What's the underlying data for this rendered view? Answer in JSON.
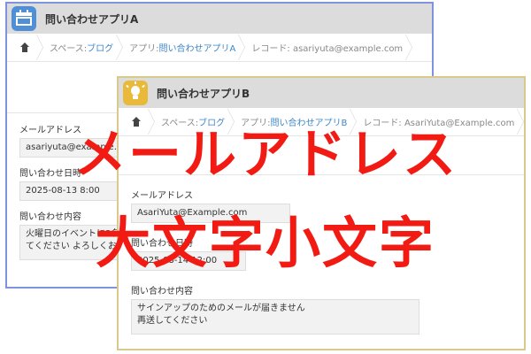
{
  "window_a": {
    "title": "問い合わせアプリA",
    "breadcrumb": {
      "space_prefix": "スペース: ",
      "space_link": "ブログ",
      "app_prefix": "アプリ: ",
      "app_link": "問い合わせアプリA",
      "record": "レコード: asariyuta@example.com"
    },
    "fields": [
      {
        "label": "メールアドレス",
        "value": "asariyuta@example.com"
      },
      {
        "label": "問い合わせ日時",
        "value": "2025-08-13 8:00"
      },
      {
        "label": "問い合わせ内容",
        "value": "火曜日のイベントに3名で参加させてください よろしくお願いします"
      }
    ],
    "border_color": "#7f93dc",
    "icon": "calendar-icon"
  },
  "window_b": {
    "title": "問い合わせアプリB",
    "breadcrumb": {
      "space_prefix": "スペース: ",
      "space_link": "ブログ",
      "app_prefix": "アプリ: ",
      "app_link": "問い合わせアプリB",
      "record": "レコード: AsariYuta@Example.com"
    },
    "fields": [
      {
        "label": "メールアドレス",
        "value": "AsariYuta@Example.com"
      },
      {
        "label": "問い合わせ日時",
        "value": "2025-08-14 12:00"
      },
      {
        "label": "問い合わせ内容",
        "value_line1": "サインアップのためのメールが届きません",
        "value_line2": "再送してください"
      }
    ],
    "border_color": "#d9c98a",
    "icon": "lightbulb-icon"
  },
  "overlay": {
    "line1": "メールアドレス",
    "line2": "大文字小文字",
    "color": "#f21b14"
  }
}
